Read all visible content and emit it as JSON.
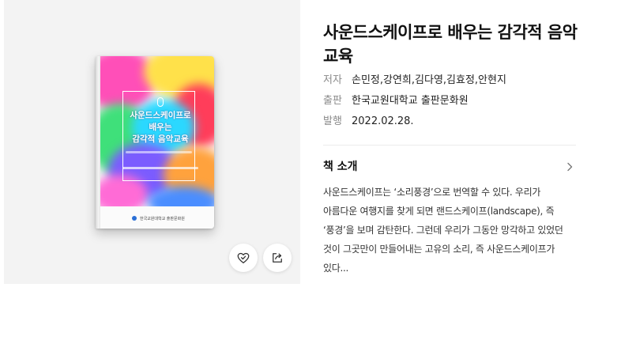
{
  "book": {
    "title": "사운드스케이프로 배우는 감각적 음악교육",
    "cover": {
      "title_line1": "사운드스케이프로",
      "title_line2": "배우는",
      "title_line3": "감각적 음악교육",
      "publisher": "한국교원대학교 출판문화원"
    },
    "meta": [
      {
        "label": "저자",
        "value": "손민정,강연희,김다영,김효정,안현지"
      },
      {
        "label": "출판",
        "value": "한국교원대학교 출판문화원"
      },
      {
        "label": "발행",
        "value": "2022.02.28."
      }
    ],
    "intro": {
      "heading": "책 소개",
      "text": "사운드스케이프는 ‘소리풍경’으로 번역할 수 있다. 우리가 아름다운 여행지를 찾게 되면 랜드스케이프(landscape), 즉 ‘풍경’을 보며 감탄한다. 그런데 우리가 그동안 망각하고 있었던 것이 그곳만이 만들어내는 고유의 소리, 즉 사운드스케이프가 있다..."
    }
  },
  "actions": {
    "like_icon": "heart-check-icon",
    "share_icon": "share-icon"
  },
  "colors": {
    "panel_bg": "#f3f3f3",
    "label": "#8a8a8a",
    "text": "#222222"
  }
}
